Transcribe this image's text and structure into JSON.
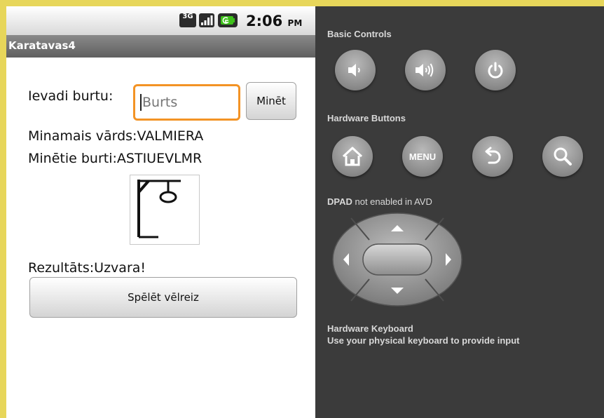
{
  "status_bar": {
    "time": "2:06",
    "ampm": "PM",
    "network_label": "3G",
    "icons": [
      "network-3g-icon",
      "signal-icon",
      "battery-icon"
    ]
  },
  "app": {
    "title": "Karatavas4",
    "input_label": "Ievadi burtu:",
    "input_placeholder": "Burts",
    "input_value": "",
    "guess_button": "Minēt",
    "word_line": "Minamais vārds:VALMIERA",
    "guessed_line": "Minētie burti:ASTIUEVLMR",
    "result_line": "Rezultāts:Uzvara!",
    "play_again_button": "Spēlēt vēlreiz",
    "image": "hangman-gallows-icon"
  },
  "emulator": {
    "basic_controls_title": "Basic Controls",
    "basic_controls": [
      "volume-down-icon",
      "volume-up-icon",
      "power-icon"
    ],
    "hardware_buttons_title": "Hardware Buttons",
    "hardware_buttons": [
      "home-icon",
      "menu",
      "back-icon",
      "search-icon"
    ],
    "menu_label": "MENU",
    "dpad_title_bold": "DPAD",
    "dpad_title_rest": " not enabled in AVD",
    "keyboard_title": "Hardware Keyboard",
    "keyboard_hint": "Use your physical keyboard to provide input"
  },
  "colors": {
    "window_border": "#e7d65a",
    "panel_bg": "#3b3b3b",
    "input_focus": "#f39325",
    "titlebar": "#6e6e6e"
  }
}
